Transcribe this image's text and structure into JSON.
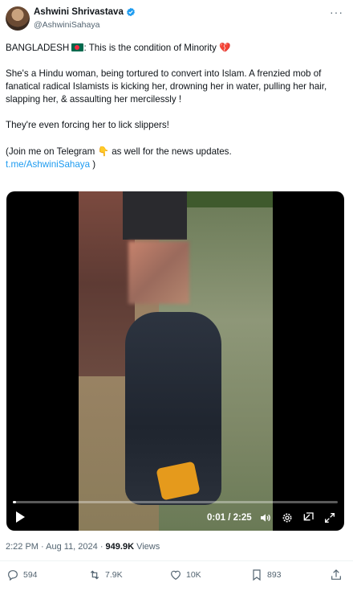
{
  "author": {
    "display_name": "Ashwini Shrivastava",
    "handle": "@AshwiniSahaya",
    "verified": true
  },
  "tweet": {
    "line1_prefix": "BANGLADESH",
    "line1_suffix": ": This is the condition of Minority",
    "paragraph2": "She's a Hindu woman, being tortured to convert into Islam. A frenzied mob of fanatical radical Islamists is kicking her, drowning her in water, pulling her hair, slapping her, & assaulting her mercilessly !",
    "paragraph3": "They're even forcing her to lick slippers!",
    "paragraph4_prefix": "(Join me on Telegram",
    "paragraph4_suffix": "as well for the news updates.",
    "link": "t.me/AshwiniSahaya",
    "paragraph4_end": ")"
  },
  "video": {
    "time": "0:01 / 2:25",
    "progress": 0.007
  },
  "meta": {
    "time": "2:22 PM · Aug 11, 2024 · ",
    "views_count": "949.9K",
    "views_label": " Views"
  },
  "actions": {
    "replies": "594",
    "reposts": "7.9K",
    "likes": "10K",
    "bookmarks": "893"
  },
  "icons": [
    "verified-badge-icon",
    "more-icon",
    "bangladesh-flag-icon",
    "broken-heart-icon",
    "pointing-hand-icon",
    "play-icon",
    "volume-icon",
    "settings-icon",
    "minimize-icon",
    "fullscreen-icon",
    "reply-icon",
    "repost-icon",
    "like-icon",
    "bookmark-icon",
    "share-icon"
  ],
  "colors": {
    "link": "#1d9bf0",
    "secondary_text": "#536471",
    "primary_text": "#0f1419",
    "verified": "#1d9bf0"
  }
}
